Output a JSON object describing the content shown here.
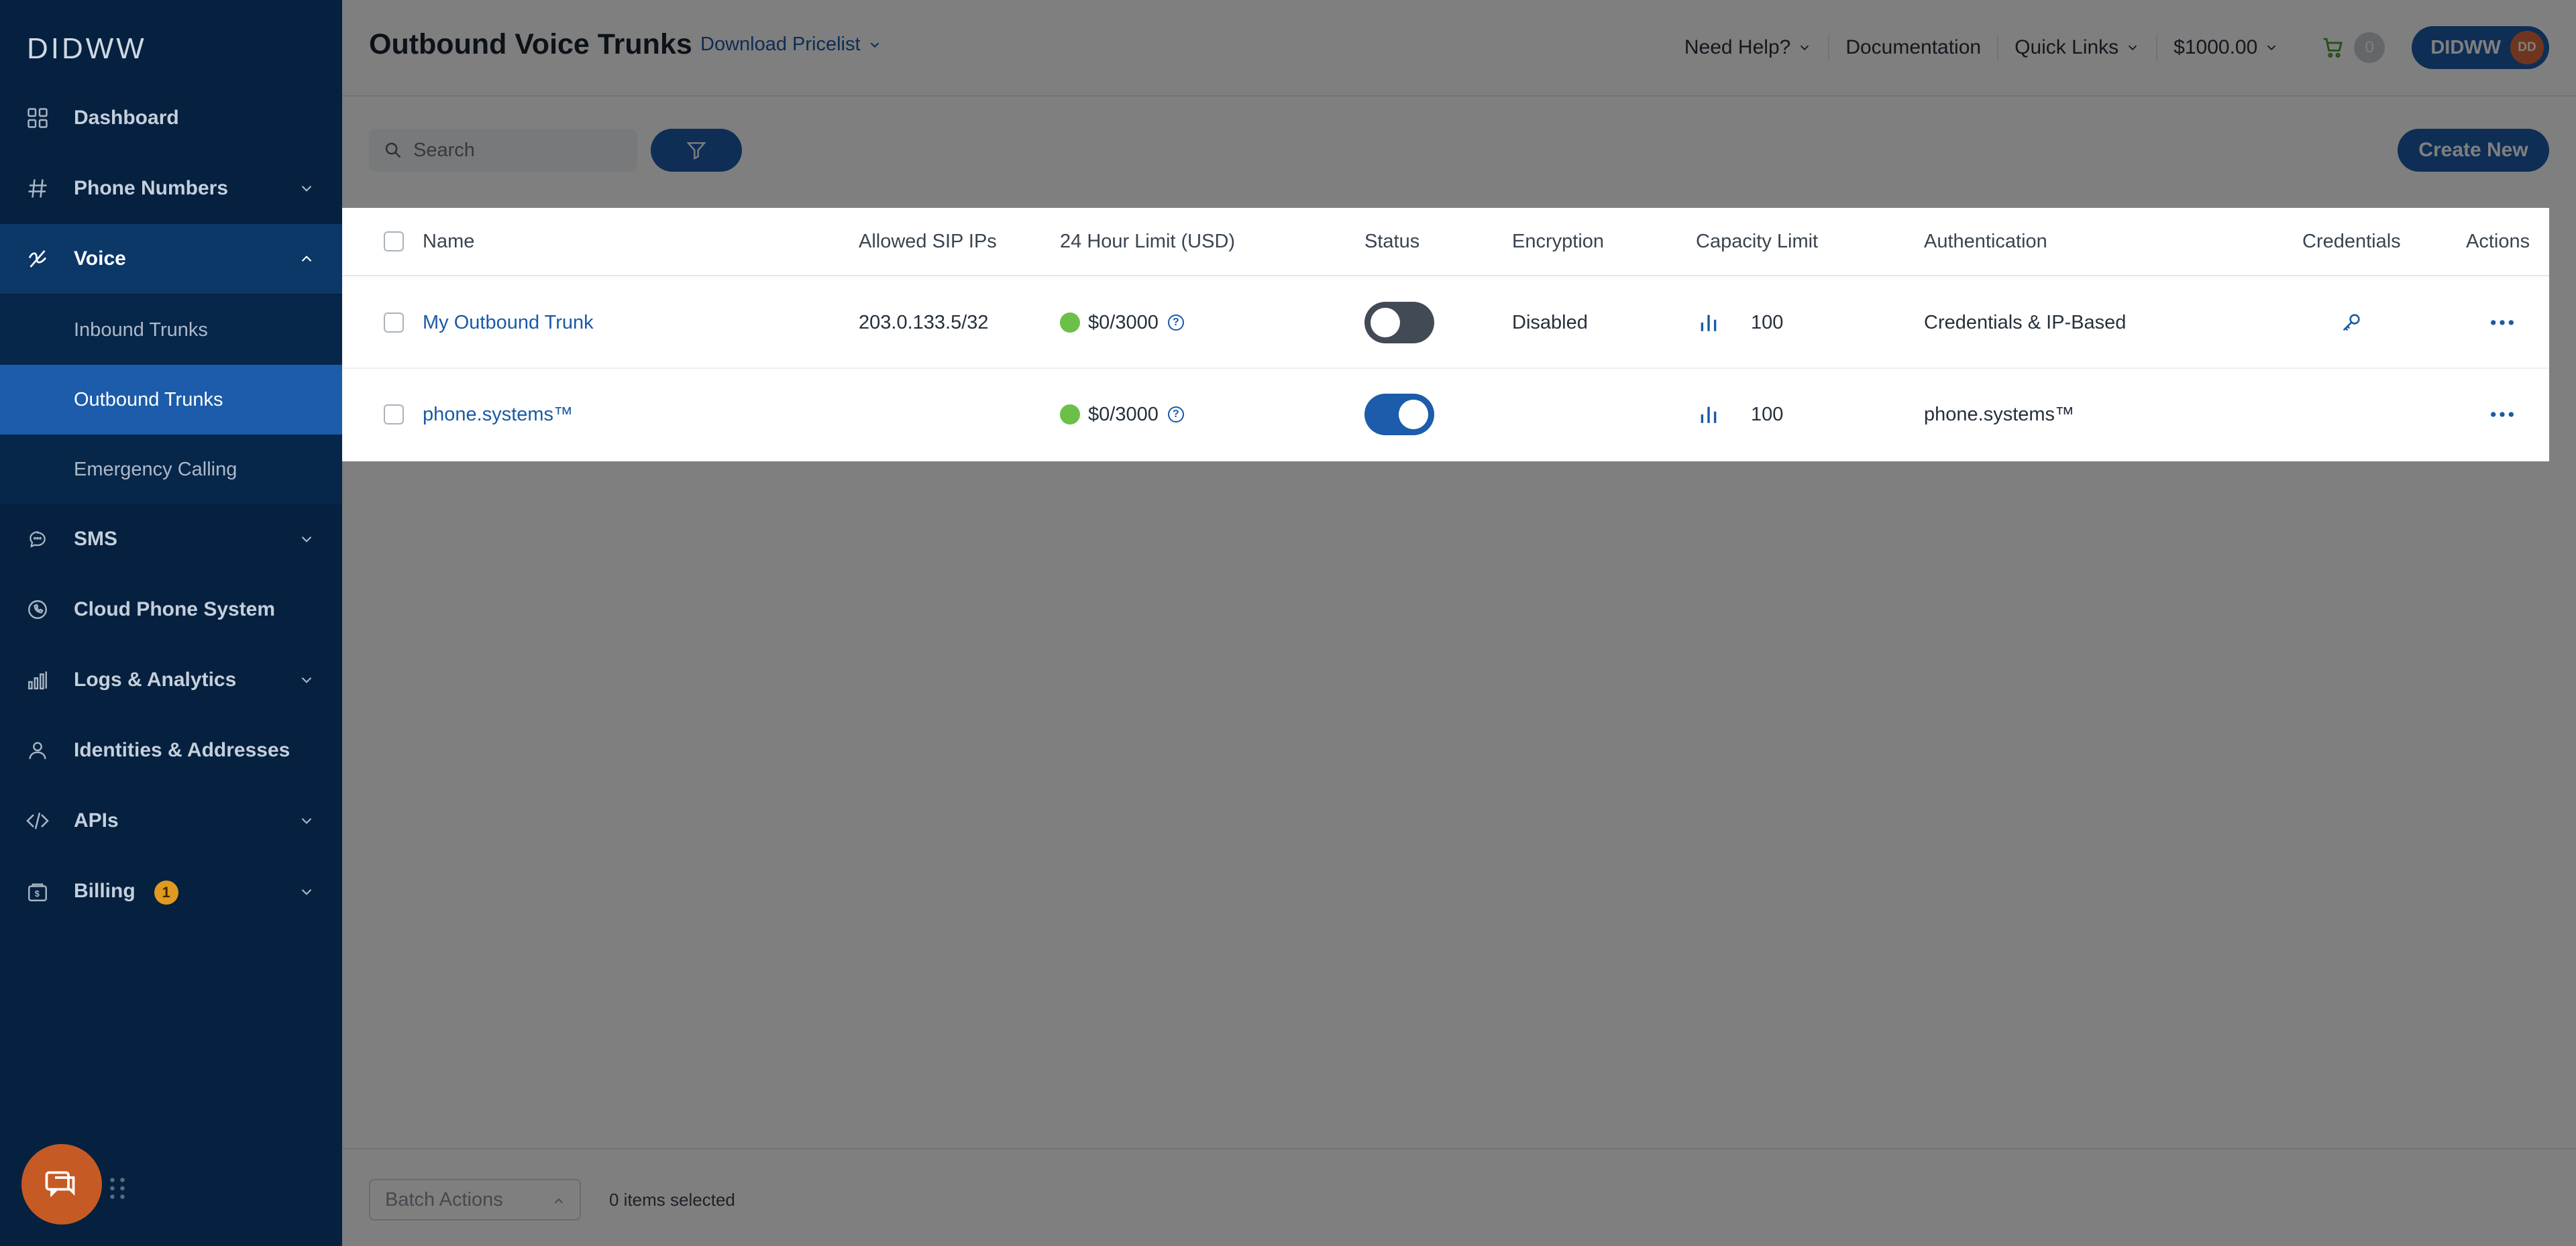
{
  "app": {
    "logo": "DIDWW"
  },
  "sidebar": {
    "items": [
      {
        "label": "Dashboard",
        "icon": "grid-icon"
      },
      {
        "label": "Phone Numbers",
        "icon": "hash-icon"
      },
      {
        "label": "Voice",
        "icon": "voice-icon"
      },
      {
        "label": "Inbound Trunks"
      },
      {
        "label": "Outbound Trunks"
      },
      {
        "label": "Emergency Calling"
      },
      {
        "label": "SMS",
        "icon": "chat-icon"
      },
      {
        "label": "Cloud Phone System",
        "icon": "phone-icon"
      },
      {
        "label": "Logs & Analytics",
        "icon": "bar-chart-icon"
      },
      {
        "label": "Identities & Addresses",
        "icon": "user-icon"
      },
      {
        "label": "APIs",
        "icon": "code-icon"
      },
      {
        "label": "Billing",
        "icon": "wallet-icon",
        "badge": "1"
      }
    ]
  },
  "header": {
    "title": "Outbound Voice Trunks",
    "pricelist": "Download Pricelist",
    "need_help": "Need Help?",
    "documentation": "Documentation",
    "quick_links": "Quick Links",
    "balance": "$1000.00",
    "cart_count": "0",
    "account_name": "DIDWW",
    "account_initials": "DD"
  },
  "toolbar": {
    "search_placeholder": "Search",
    "create_label": "Create New"
  },
  "table": {
    "columns": [
      "Name",
      "Allowed SIP IPs",
      "24 Hour Limit (USD)",
      "Status",
      "Encryption",
      "Capacity Limit",
      "Authentication",
      "Credentials",
      "Actions"
    ],
    "rows": [
      {
        "name": "My Outbound Trunk",
        "sip_ips": "203.0.133.5/32",
        "limit": "$0/3000",
        "status_on": false,
        "encryption": "Disabled",
        "capacity": "100",
        "authentication": "Credentials & IP-Based",
        "has_credentials": true
      },
      {
        "name": "phone.systems™",
        "sip_ips": "",
        "limit": "$0/3000",
        "status_on": true,
        "encryption": "",
        "capacity": "100",
        "authentication": "phone.systems™",
        "has_credentials": false
      }
    ]
  },
  "footer": {
    "batch_actions": "Batch Actions",
    "selected_count": "0 items selected"
  },
  "colors": {
    "sidebar_bg": "#05213f",
    "accent": "#1c5caa",
    "status_green": "#6cc04a",
    "billing_badge": "#e19a1f",
    "chat_button": "#c65a24"
  }
}
